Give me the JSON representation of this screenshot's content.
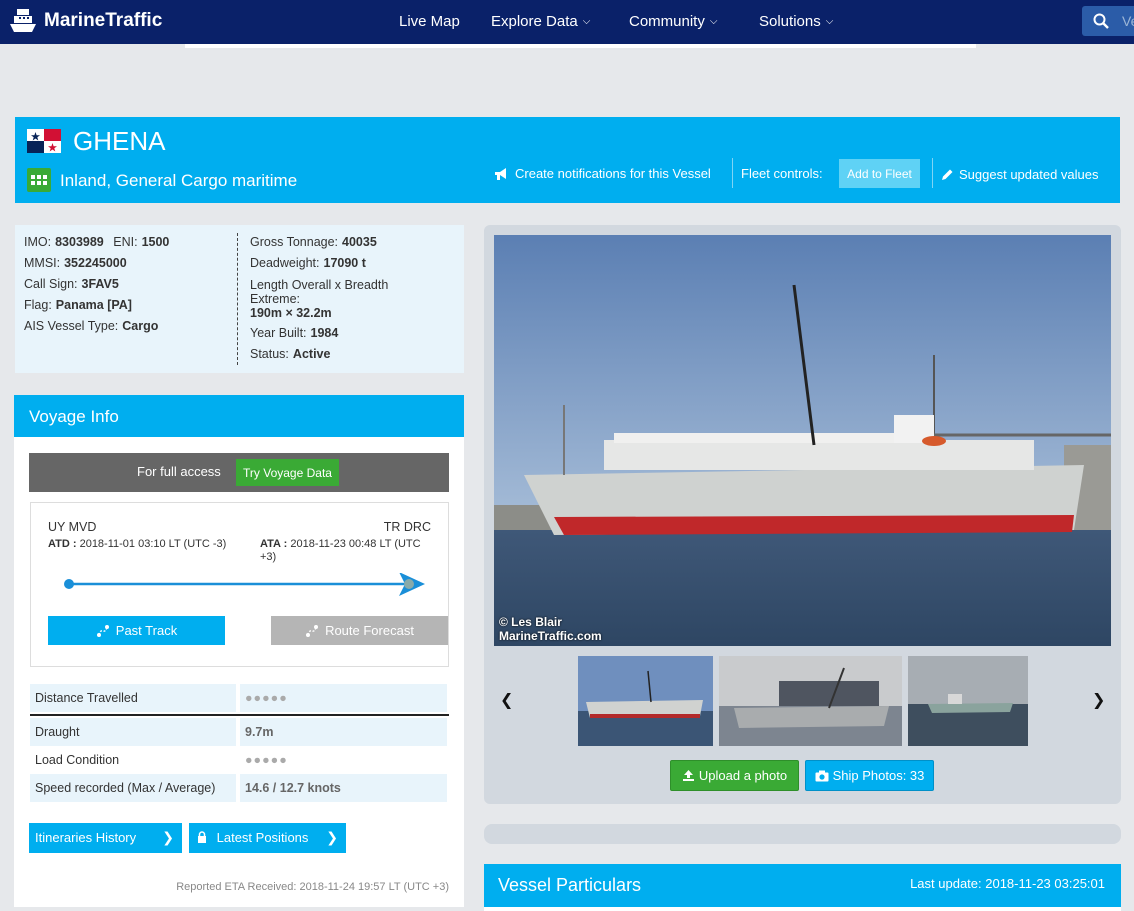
{
  "nav": {
    "brand": "MarineTraffic",
    "items": [
      {
        "label": "Live Map",
        "dropdown": false
      },
      {
        "label": "Explore Data",
        "dropdown": true
      },
      {
        "label": "Community",
        "dropdown": true
      },
      {
        "label": "Solutions",
        "dropdown": true
      }
    ],
    "search_placeholder": "Ve"
  },
  "vessel": {
    "name": "GHENA",
    "type": "Inland, General Cargo maritime",
    "flag_icon": "panama-flag-icon"
  },
  "banner_actions": {
    "notifications": "Create notifications for this Vessel",
    "fleet_label": "Fleet controls:",
    "add_fleet": "Add to Fleet",
    "suggest": "Suggest updated values"
  },
  "info": {
    "left": [
      {
        "k": "IMO:",
        "v": "8303989",
        "k2": "ENI:",
        "v2": "1500"
      },
      {
        "k": "MMSI:",
        "v": "352245000"
      },
      {
        "k": "Call Sign:",
        "v": "3FAV5"
      },
      {
        "k": "Flag:",
        "v": "Panama [PA]"
      },
      {
        "k": "AIS Vessel Type:",
        "v": "Cargo"
      }
    ],
    "right": {
      "gross_label": "Gross Tonnage:",
      "gross": "40035",
      "dw_label": "Deadweight:",
      "dw": "17090 t",
      "length_label_1": "Length Overall x Breadth",
      "length_label_2": "Extreme:",
      "length": "190m × 32.2m",
      "year_label": "Year Built:",
      "year": "1984",
      "status_label": "Status:",
      "status": "Active"
    }
  },
  "voyage": {
    "title": "Voyage Info",
    "access_text": "For full access",
    "try_button": "Try Voyage Data",
    "from_country": "UY",
    "from_port": "MVD",
    "to_country": "TR",
    "to_port": "DRC",
    "atd_label": "ATD :",
    "atd": "2018-11-01 03:10 LT (UTC -3)",
    "ata_label": "ATA :",
    "ata": "2018-11-23 00:48 LT (UTC +3)",
    "past_track": "Past Track",
    "route_forecast": "Route Forecast",
    "stats": [
      {
        "k": "Distance Travelled",
        "v": "●●●●●"
      },
      {
        "k": "Draught",
        "v": "9.7m"
      },
      {
        "k": "Load Condition",
        "v": "●●●●●"
      },
      {
        "k": "Speed recorded (Max / Average)",
        "v": "14.6 / 12.7 knots"
      }
    ],
    "itineraries": "Itineraries History",
    "latest_positions": "Latest Positions",
    "reported_eta": "Reported ETA Received: 2018-11-24 19:57 LT (UTC +3)"
  },
  "photos": {
    "credit_1": "© Les Blair",
    "credit_2": "MarineTraffic.com",
    "upload": "Upload a photo",
    "ship_photos": "Ship Photos: 33"
  },
  "particulars": {
    "title": "Vessel Particulars",
    "last_update": "Last update: 2018-11-23 03:25:01"
  },
  "colors": {
    "nav_bg": "#0a2169",
    "accent": "#00aeef",
    "green": "#3aaa35"
  }
}
